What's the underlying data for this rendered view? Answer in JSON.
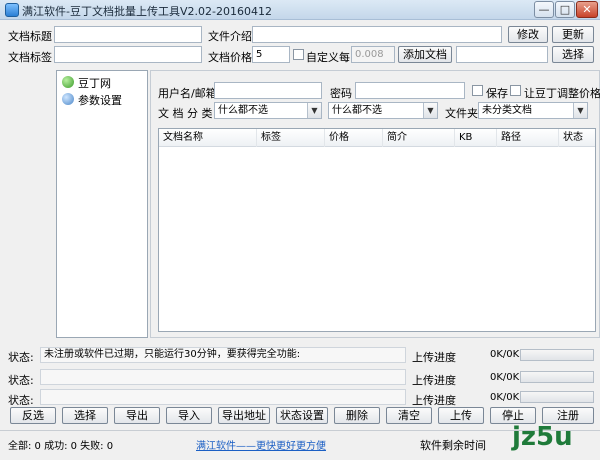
{
  "window": {
    "title": "满江软件-豆丁文档批量上传工具V2.02-20160412",
    "min_label": "—",
    "max_label": "□",
    "close_label": "✕"
  },
  "top_form": {
    "doc_title_label": "文档标题",
    "doc_title_value": "",
    "doc_intro_label": "文件介绍",
    "doc_intro_value": "",
    "modify_button": "修改",
    "update_button": "更新",
    "doc_tags_label": "文档标签",
    "doc_tags_value": "",
    "doc_price_label": "文档价格",
    "doc_price_value": "5",
    "custom_price_label": "自定义每K",
    "custom_price_value": "0.008",
    "add_doc_button": "添加文档",
    "choose_button": "选择"
  },
  "tree": {
    "items": [
      {
        "label": "豆丁网",
        "icon": "globe-icon"
      },
      {
        "label": "参数设置",
        "icon": "settings-icon"
      }
    ]
  },
  "account": {
    "user_label": "用户名/邮箱",
    "user_value": "",
    "password_label": "密码",
    "password_value": "",
    "save_label": "保存",
    "let_adjust_label": "让豆丁调整价格",
    "category_label": "文 档 分 类",
    "category1_value": "什么都不选",
    "category2_value": "什么都不选",
    "folder_label": "文件夹",
    "folder_value": "未分类文档"
  },
  "table": {
    "columns": [
      "文档名称",
      "标签",
      "价格",
      "简介",
      "KB",
      "路径",
      "状态"
    ],
    "rows": []
  },
  "status_rows": [
    {
      "label": "状态:",
      "text": "未注册或软件已过期，只能运行30分钟，要获得完全功能:",
      "progress_label": "上传进度",
      "progress_text": "0K/0K",
      "progress": 0
    },
    {
      "label": "状态:",
      "text": "",
      "progress_label": "上传进度",
      "progress_text": "0K/0K",
      "progress": 0
    },
    {
      "label": "状态:",
      "text": "",
      "progress_label": "上传进度",
      "progress_text": "0K/0K",
      "progress": 0
    }
  ],
  "toolbar": {
    "buttons": [
      "反选",
      "选择",
      "导出",
      "导入",
      "导出地址",
      "状态设置",
      "删除",
      "清空",
      "上传",
      "停止",
      "注册"
    ]
  },
  "footer": {
    "counts": "全部: 0 成功: 0 失败: 0",
    "link": "满江软件——更快更好更方便",
    "remaining_label": "软件剩余时间",
    "logo": "jz5u"
  }
}
